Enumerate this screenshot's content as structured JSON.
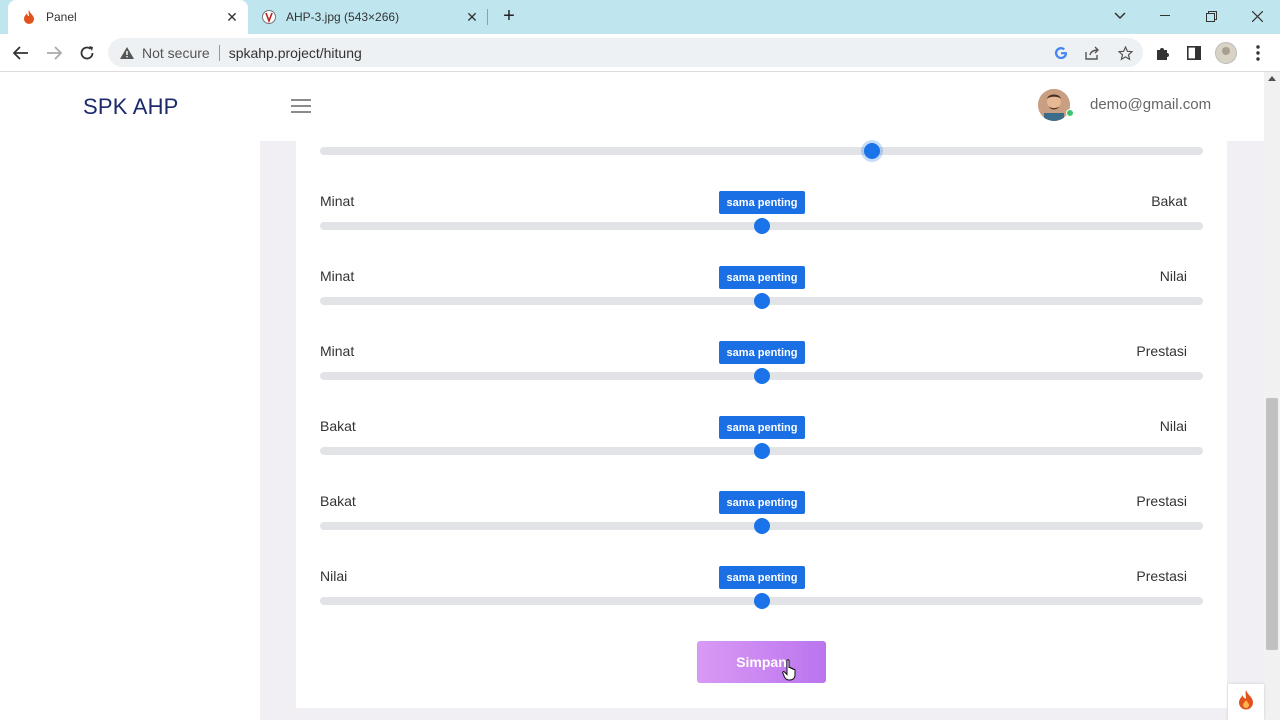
{
  "browser": {
    "tabs": [
      {
        "title": "Panel",
        "icon": "flame-icon"
      },
      {
        "title": "AHP-3.jpg (543×266)",
        "icon": "image-icon"
      }
    ],
    "address": {
      "security_label": "Not secure",
      "url": "spkahp.project/hitung"
    }
  },
  "header": {
    "brand": "SPK AHP",
    "user_email": "demo@gmail.com"
  },
  "comparisons": [
    {
      "left": "",
      "right": "",
      "badge": "",
      "value_fraction": 0.625
    },
    {
      "left": "Minat",
      "right": "Bakat",
      "badge": "sama penting",
      "value_fraction": 0.5
    },
    {
      "left": "Minat",
      "right": "Nilai",
      "badge": "sama penting",
      "value_fraction": 0.5
    },
    {
      "left": "Minat",
      "right": "Prestasi",
      "badge": "sama penting",
      "value_fraction": 0.5
    },
    {
      "left": "Bakat",
      "right": "Nilai",
      "badge": "sama penting",
      "value_fraction": 0.5
    },
    {
      "left": "Bakat",
      "right": "Prestasi",
      "badge": "sama penting",
      "value_fraction": 0.5
    },
    {
      "left": "Nilai",
      "right": "Prestasi",
      "badge": "sama penting",
      "value_fraction": 0.5
    }
  ],
  "actions": {
    "submit_label": "Simpan"
  },
  "colors": {
    "accent": "#1a6fe4",
    "brand": "#1c2a6b",
    "button_gradient_start": "#d99af5",
    "button_gradient_end": "#bb74ee"
  }
}
